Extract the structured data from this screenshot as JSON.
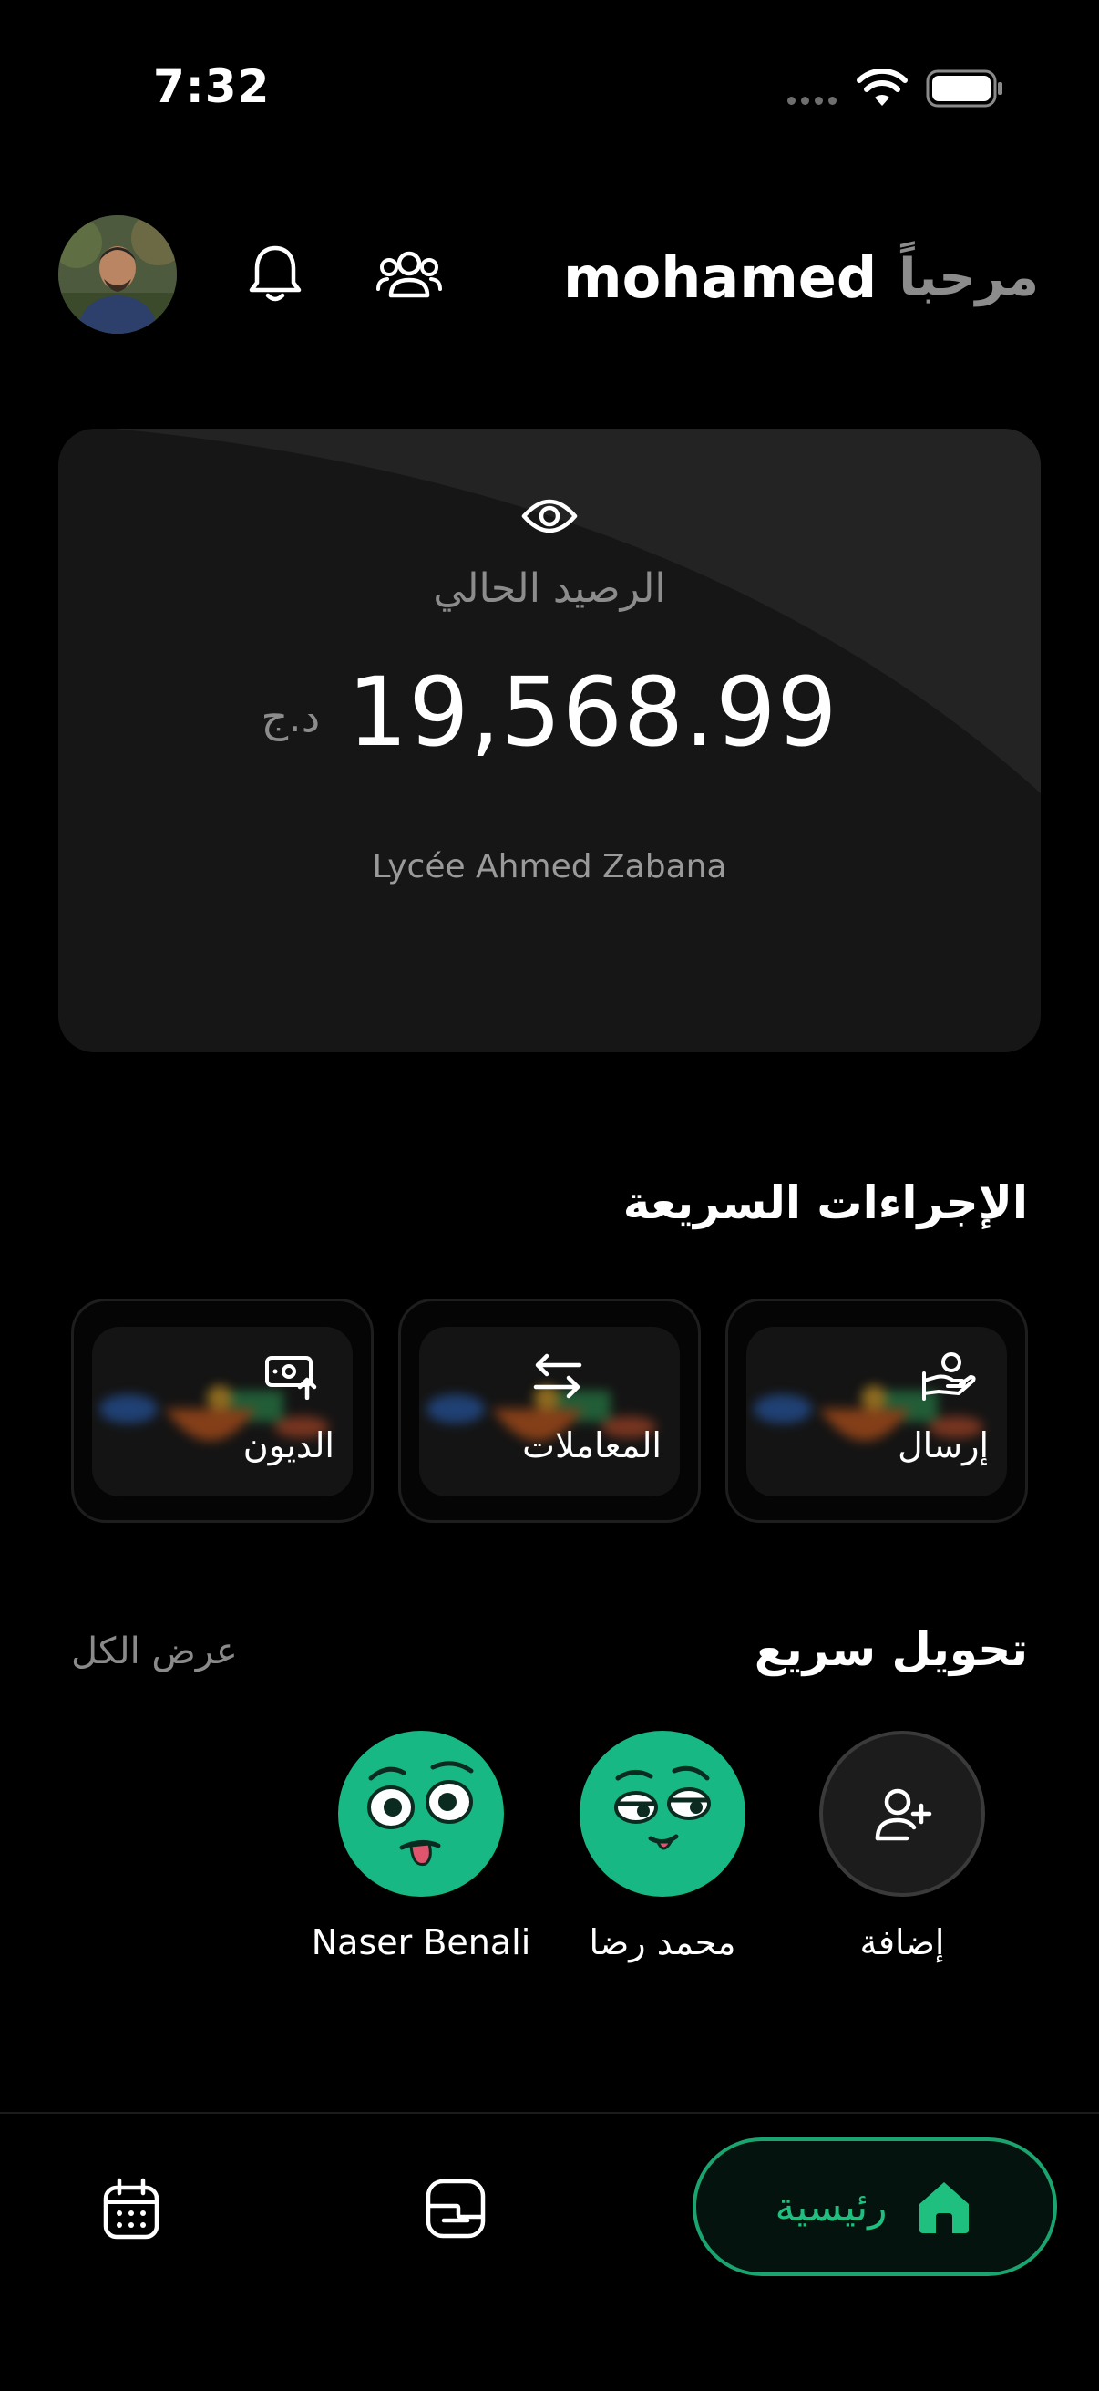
{
  "status_bar": {
    "time": "7:32"
  },
  "header": {
    "greeting": "مرحباً",
    "user_name": "mohamed"
  },
  "balance": {
    "label": "الرصيد الحالي",
    "amount": "19,568.99",
    "currency": "د.ج",
    "school": "Lycée Ahmed Zabana"
  },
  "quick_actions": {
    "title": "الإجراءات السريعة",
    "items": [
      {
        "label": "إرسال",
        "icon": "send-money-icon"
      },
      {
        "label": "المعاملات",
        "icon": "transfer-arrows-icon"
      },
      {
        "label": "الديون",
        "icon": "debt-icon"
      }
    ]
  },
  "quick_transfer": {
    "title": "تحويل سريع",
    "view_all": "عرض الكل",
    "contacts": [
      {
        "name": "إضافة",
        "type": "add"
      },
      {
        "name": "محمد رضا",
        "type": "face"
      },
      {
        "name": "Naser Benali",
        "type": "face"
      }
    ]
  },
  "bottom_nav": {
    "home_label": "رئيسية",
    "items": [
      "home-icon",
      "wallet-icon",
      "calendar-icon"
    ]
  },
  "colors": {
    "accent": "#18b884",
    "nav_active": "#1fbf80",
    "background": "#000000"
  }
}
